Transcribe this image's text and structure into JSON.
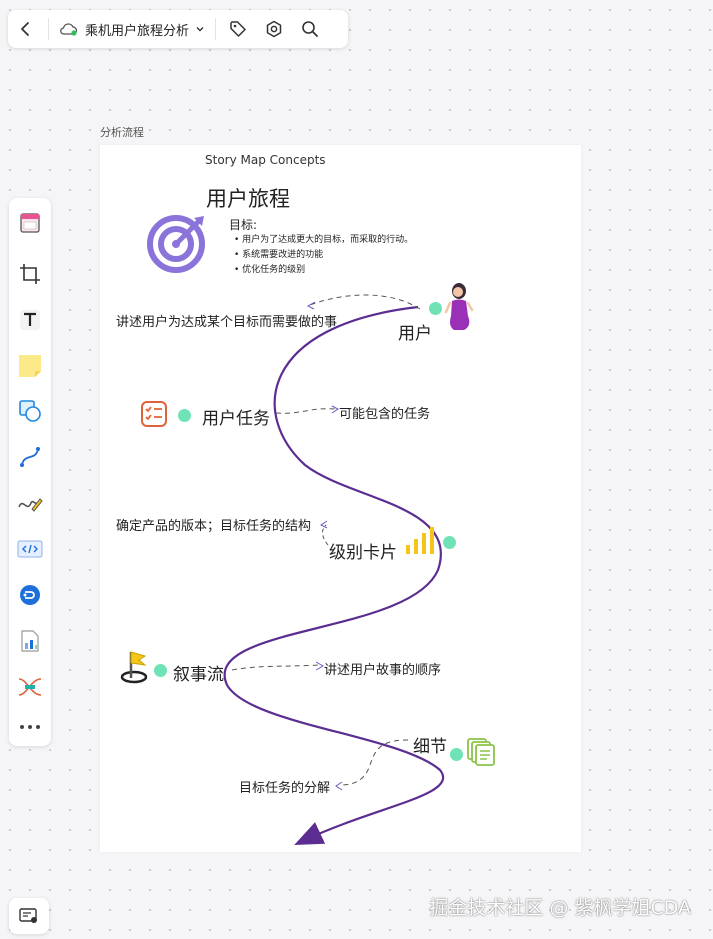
{
  "topbar": {
    "doc_title": "乘机用户旅程分析",
    "icons": [
      "back-arrow-icon",
      "cloud-sync-icon",
      "chevron-down-icon",
      "tag-icon",
      "settings-icon",
      "search-icon"
    ]
  },
  "frame": {
    "label": "分析流程"
  },
  "board": {
    "subtitle": "Story Map Concepts",
    "title": "用户旅程",
    "goal_label": "目标:",
    "goals": [
      "用户为了达成更大的目标，而采取的行动。",
      "系统需要改进的功能",
      "优化任务的级别"
    ],
    "nodes": {
      "user": {
        "label": "用户",
        "note": "讲述用户为达成某个目标而需要做的事"
      },
      "task": {
        "label": "用户任务",
        "note": "可能包含的任务"
      },
      "level": {
        "label": "级别卡片",
        "note": "确定产品的版本；目标任务的结构"
      },
      "narrative": {
        "label": "叙事流",
        "note": "讲述用户故事的顺序"
      },
      "detail": {
        "label": "细节",
        "note": "目标任务的分解"
      }
    },
    "colors": {
      "path": "#5b2d91",
      "dot": "#6fe3b5",
      "target": "#8a73d9",
      "task_icon": "#e0623a",
      "bars": "#f5c518",
      "pages": "#8bc34a"
    }
  },
  "toolbar": {
    "tools": [
      "frame-template-tool",
      "crop-frame-tool",
      "text-tool",
      "sticky-note-tool",
      "shape-tool",
      "connector-tool",
      "pen-tool",
      "code-block-tool",
      "mind-map-tool",
      "chart-tool",
      "flow-tool",
      "more-tool"
    ]
  },
  "watermark": "掘金技术社区 @ 紫枫学姐CDA"
}
